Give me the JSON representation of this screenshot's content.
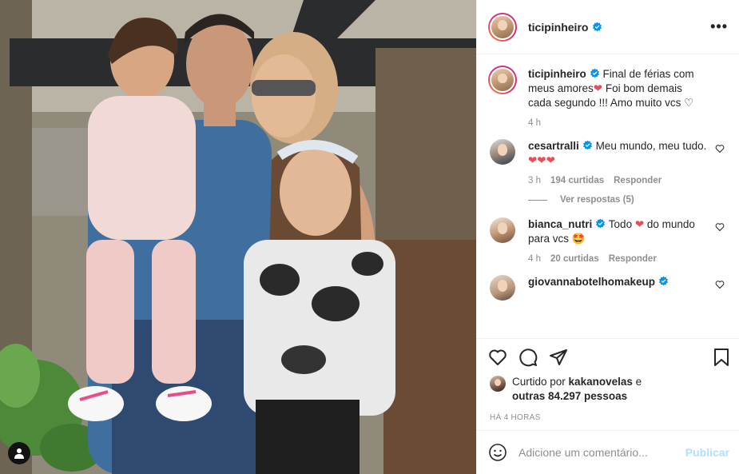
{
  "post": {
    "username": "ticipinheiro",
    "verified": true,
    "photo_description_icon": "family-photo",
    "more_icon": "more-options-icon",
    "more_label": "•••"
  },
  "caption": {
    "username": "ticipinheiro",
    "text_1": "Final de férias com meus amores",
    "heart_1": "❤",
    "text_2": " Foi bom demais cada segundo !!! Amo muito vcs ",
    "heart_2": "♡",
    "time": "4 h"
  },
  "comments": [
    {
      "username": "cesartralli",
      "text": "Meu mundo, meu tudo. ",
      "emoji": "❤❤❤",
      "time": "3 h",
      "likes": "194 curtidas",
      "reply": "Responder"
    },
    {
      "username": "bianca_nutri",
      "text_before": "Todo ",
      "emoji_mid": "❤",
      "text_after": " do mundo para vcs ",
      "emoji_end": "🤩",
      "time": "4 h",
      "likes": "20 curtidas",
      "reply": "Responder"
    },
    {
      "username": "giovannabotelhomakeup"
    }
  ],
  "view_replies": "Ver respostas (5)",
  "liked_by": {
    "prefix": "Curtido por ",
    "user": "kakanovelas",
    "middle": " e",
    "others": "outras 84.297 pessoas"
  },
  "timestamp": "HÁ 4 HORAS",
  "add_comment": {
    "placeholder": "Adicione um comentário...",
    "publish_label": "Publicar"
  },
  "colors": {
    "accent_link": "#0095f6",
    "publish_disabled": "#b2dffc",
    "heart_red": "#ed4956",
    "text": "#262626",
    "muted": "#8e8e8e"
  }
}
